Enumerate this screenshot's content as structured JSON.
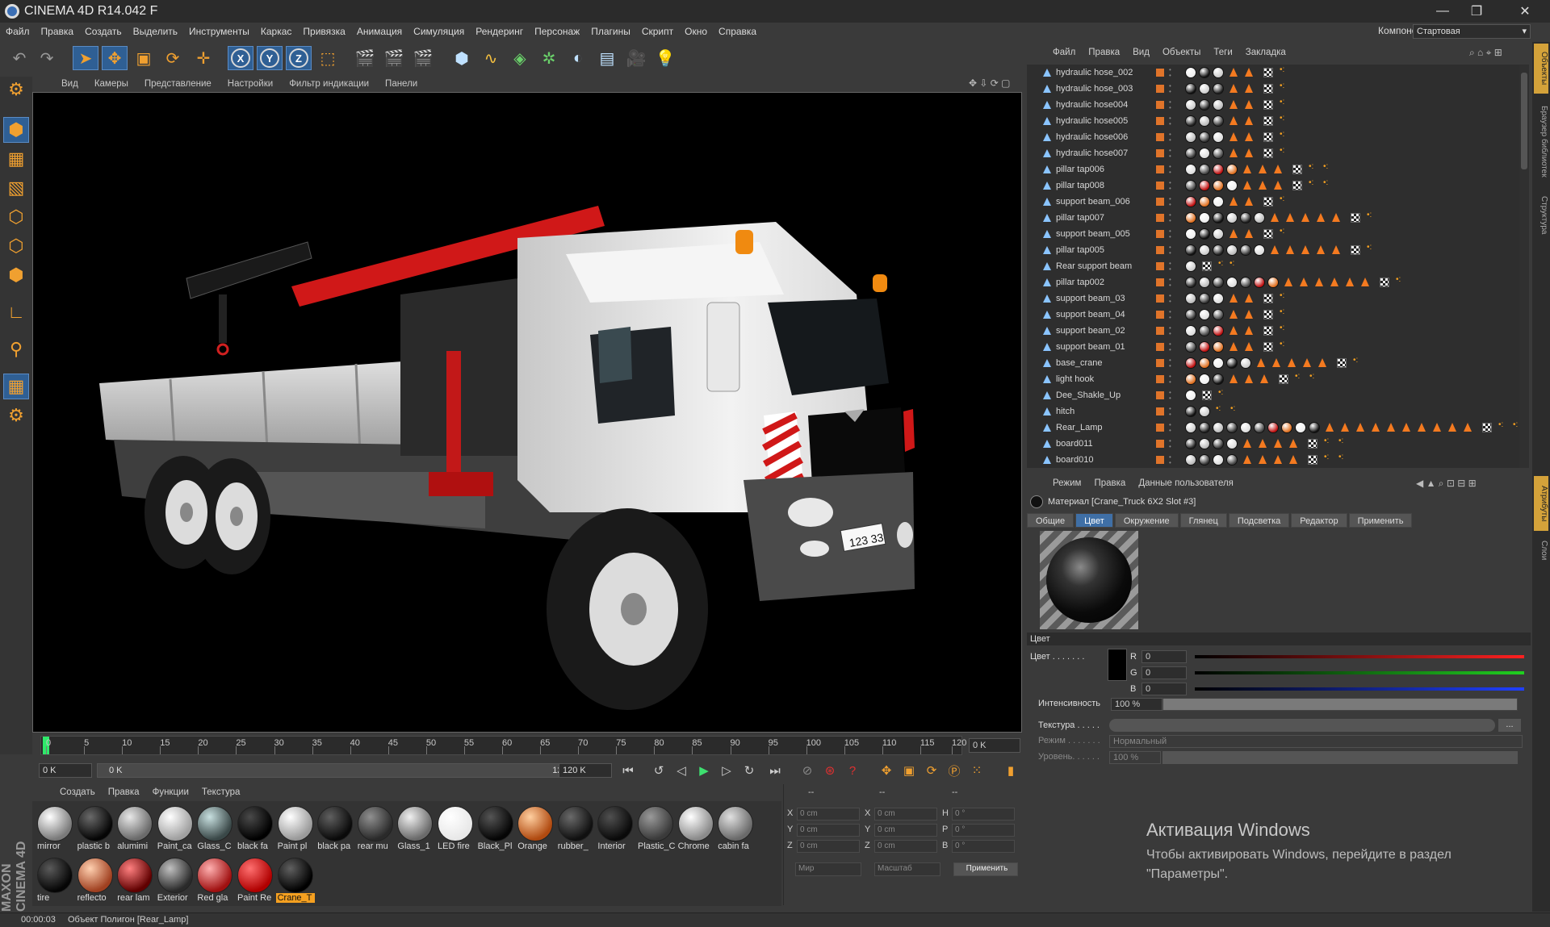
{
  "window": {
    "title": "CINEMA 4D R14.042 F",
    "min": "—",
    "max": "❐",
    "close": "✕"
  },
  "menu": [
    "Файл",
    "Правка",
    "Создать",
    "Выделить",
    "Инструменты",
    "Каркас",
    "Привязка",
    "Анимация",
    "Симуляция",
    "Рендеринг",
    "Персонаж",
    "Плагины",
    "Скрипт",
    "Окно",
    "Справка"
  ],
  "layout": {
    "label": "Компоновка",
    "value": "Стартовая"
  },
  "viewport_menu": [
    "Вид",
    "Камеры",
    "Представление",
    "Настройки",
    "Фильтр индикации",
    "Панели"
  ],
  "plate": "123 33",
  "timeline": {
    "ticks": [
      "0",
      "5",
      "10",
      "15",
      "20",
      "25",
      "30",
      "35",
      "40",
      "45",
      "50",
      "55",
      "60",
      "65",
      "70",
      "75",
      "80",
      "85",
      "90",
      "95",
      "100",
      "105",
      "110",
      "115",
      "120"
    ],
    "end_frame": "0 K",
    "start": "0 K",
    "range_left": "0 K",
    "range_right": "120 K",
    "max": "120 K"
  },
  "materials_menu": [
    "Создать",
    "Правка",
    "Функции",
    "Текстура"
  ],
  "materials": [
    {
      "name": "mirror",
      "c1": "#ffffff",
      "c2": "#7a7a7a"
    },
    {
      "name": "plastic b",
      "c1": "#6a6a6a",
      "c2": "#050505"
    },
    {
      "name": "alumimi",
      "c1": "#e8e8e8",
      "c2": "#6a6a6a"
    },
    {
      "name": "Paint_ca",
      "c1": "#ffffff",
      "c2": "#a0a0a0"
    },
    {
      "name": "Glass_C",
      "c1": "#c8e0e0",
      "c2": "#3a4848"
    },
    {
      "name": "black fa",
      "c1": "#4a4a4a",
      "c2": "#000000"
    },
    {
      "name": "Paint pl",
      "c1": "#ffffff",
      "c2": "#9a9a9a"
    },
    {
      "name": "black pa",
      "c1": "#606060",
      "c2": "#0a0a0a"
    },
    {
      "name": "rear mu",
      "c1": "#909090",
      "c2": "#2a2a2a"
    },
    {
      "name": "Glass_1",
      "c1": "#f0f0f0",
      "c2": "#6a6a6a"
    },
    {
      "name": "LED fire",
      "c1": "#ffffff",
      "c2": "#e8e8e8"
    },
    {
      "name": "Black_Pl",
      "c1": "#555555",
      "c2": "#050505"
    },
    {
      "name": "Orange",
      "c1": "#ffcfa0",
      "c2": "#b04a10"
    },
    {
      "name": "rubber_",
      "c1": "#6a6a6a",
      "c2": "#101010"
    },
    {
      "name": "Interior",
      "c1": "#505050",
      "c2": "#0a0a0a"
    },
    {
      "name": "Plastic_C",
      "c1": "#9a9a9a",
      "c2": "#3a3a3a"
    },
    {
      "name": "Chrome",
      "c1": "#ffffff",
      "c2": "#8a8a8a"
    },
    {
      "name": "cabin fa",
      "c1": "#e0e0e0",
      "c2": "#6a6a6a"
    },
    {
      "name": "tire",
      "c1": "#5a5a5a",
      "c2": "#050505"
    },
    {
      "name": "reflecto",
      "c1": "#ffd0b0",
      "c2": "#a04020"
    },
    {
      "name": "rear lam",
      "c1": "#ff8080",
      "c2": "#600000"
    },
    {
      "name": "Exterior",
      "c1": "#c0c0c0",
      "c2": "#2a2a2a"
    },
    {
      "name": "Red gla",
      "c1": "#ffb0b0",
      "c2": "#a01010"
    },
    {
      "name": "Paint Re",
      "c1": "#ff7070",
      "c2": "#b00000"
    },
    {
      "name": "Crane_T",
      "c1": "#606060",
      "c2": "#000000"
    }
  ],
  "coords": {
    "header": [
      "--",
      "--",
      "--"
    ],
    "rows": [
      {
        "a": "X",
        "av": "0 cm",
        "b": "X",
        "bv": "0 cm",
        "c": "H",
        "cv": "0 °"
      },
      {
        "a": "Y",
        "av": "0 cm",
        "b": "Y",
        "bv": "0 cm",
        "c": "P",
        "cv": "0 °"
      },
      {
        "a": "Z",
        "av": "0 cm",
        "b": "Z",
        "bv": "0 cm",
        "c": "B",
        "cv": "0 °"
      }
    ],
    "mode1": "Мир",
    "mode2": "Масштаб",
    "apply": "Применить"
  },
  "object_menu": [
    "Файл",
    "Правка",
    "Вид",
    "Объекты",
    "Теги",
    "Закладка"
  ],
  "objects": [
    {
      "name": "hydraulic hose_002",
      "tags": "bbb tt c d"
    },
    {
      "name": "hydraulic hose_003",
      "tags": "bbb tt c d"
    },
    {
      "name": "hydraulic hose004",
      "tags": "bbb tt c d"
    },
    {
      "name": "hydraulic hose005",
      "tags": "bbb tt c d"
    },
    {
      "name": "hydraulic hose006",
      "tags": "bbb tt c d"
    },
    {
      "name": "hydraulic hose007",
      "tags": "bbb tt c d"
    },
    {
      "name": "pillar tap006",
      "tags": "bbbb ttt c d d"
    },
    {
      "name": "pillar tap008",
      "tags": "bbbb ttt c d d"
    },
    {
      "name": "support beam_006",
      "tags": "bbb tt c d"
    },
    {
      "name": "pillar tap007",
      "tags": "bbbbbb ttttt c d"
    },
    {
      "name": "support beam_005",
      "tags": "bbb tt c d"
    },
    {
      "name": "pillar tap005",
      "tags": "bbbbbb ttttt c d"
    },
    {
      "name": "Rear support beam",
      "tags": "b c dd"
    },
    {
      "name": "pillar tap002",
      "tags": "bbbbbbb tttttt c d"
    },
    {
      "name": "support beam_03",
      "tags": "bbb tt c d"
    },
    {
      "name": "support beam_04",
      "tags": "bbb tt c d"
    },
    {
      "name": "support beam_02",
      "tags": "bbb tt c d"
    },
    {
      "name": "support beam_01",
      "tags": "bbb tt c d"
    },
    {
      "name": "base_crane",
      "tags": "bbbbb ttttt c d"
    },
    {
      "name": "light hook",
      "tags": "bbb ttt c d d"
    },
    {
      "name": "Dee_Shakle_Up",
      "tags": "b c d"
    },
    {
      "name": "hitch",
      "tags": "bb d d"
    },
    {
      "name": "Rear_Lamp",
      "tags": "bbbbbbbbbb tttttttttt c d d"
    },
    {
      "name": "board011",
      "tags": "bbbb tttt c d d"
    },
    {
      "name": "board010",
      "tags": "bbbb tttt c d d"
    }
  ],
  "attr_menu": [
    "Режим",
    "Правка",
    "Данные пользователя"
  ],
  "attr_title": "Материал [Crane_Truck 6X2 Slot #3]",
  "attr_tabs": [
    "Общие",
    "Цвет",
    "Окружение",
    "Глянец",
    "Подсветка",
    "Редактор",
    "Применить"
  ],
  "color_section": "Цвет",
  "color": {
    "label": "Цвет . . . . . . .",
    "r_label": "R",
    "g_label": "G",
    "b_label": "B",
    "r": "0",
    "g": "0",
    "b": "0"
  },
  "intensity": {
    "label": "Интенсивность",
    "value": "100 %",
    "level": 1.0
  },
  "texture": {
    "label": "Текстура . . . . .",
    "btn": "..."
  },
  "blend_mode": {
    "label": "Режим . . . . . . .",
    "value": "Нормальный"
  },
  "blend_level": {
    "label": "Уровень. . . . . .",
    "value": "100 %"
  },
  "side_tabs": [
    "Объекты",
    "Браузер библиотек",
    "Структура",
    "Атрибуты",
    "Слои"
  ],
  "watermark": {
    "title": "Активация Windows",
    "line1": "Чтобы активировать Windows, перейдите в раздел",
    "line2": "\"Параметры\"."
  },
  "status": {
    "time": "00:00:03",
    "text": "Объект Полигон [Rear_Lamp]"
  },
  "maxon": "MAXON CINEMA 4D"
}
